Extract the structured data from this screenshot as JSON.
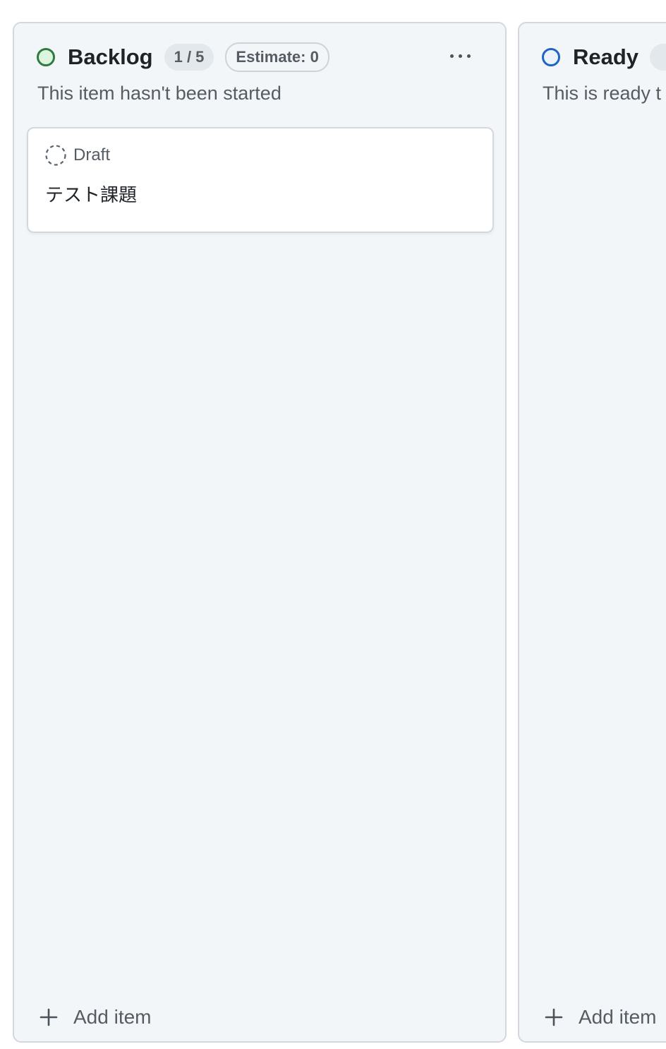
{
  "columns": [
    {
      "title": "Backlog",
      "count": "1 / 5",
      "estimate": "Estimate: 0",
      "description": "This item hasn't been started",
      "status_color": "#2f7a3e",
      "add_item_label": "Add item",
      "more_icon": "kebab-horizontal-icon",
      "cards": [
        {
          "type_label": "Draft",
          "type_icon": "draft-issue-icon",
          "title": "テスト課題"
        }
      ]
    },
    {
      "title": "Ready",
      "description": "This is ready t",
      "status_color": "#1f63c4",
      "add_item_label": "Add item"
    }
  ]
}
